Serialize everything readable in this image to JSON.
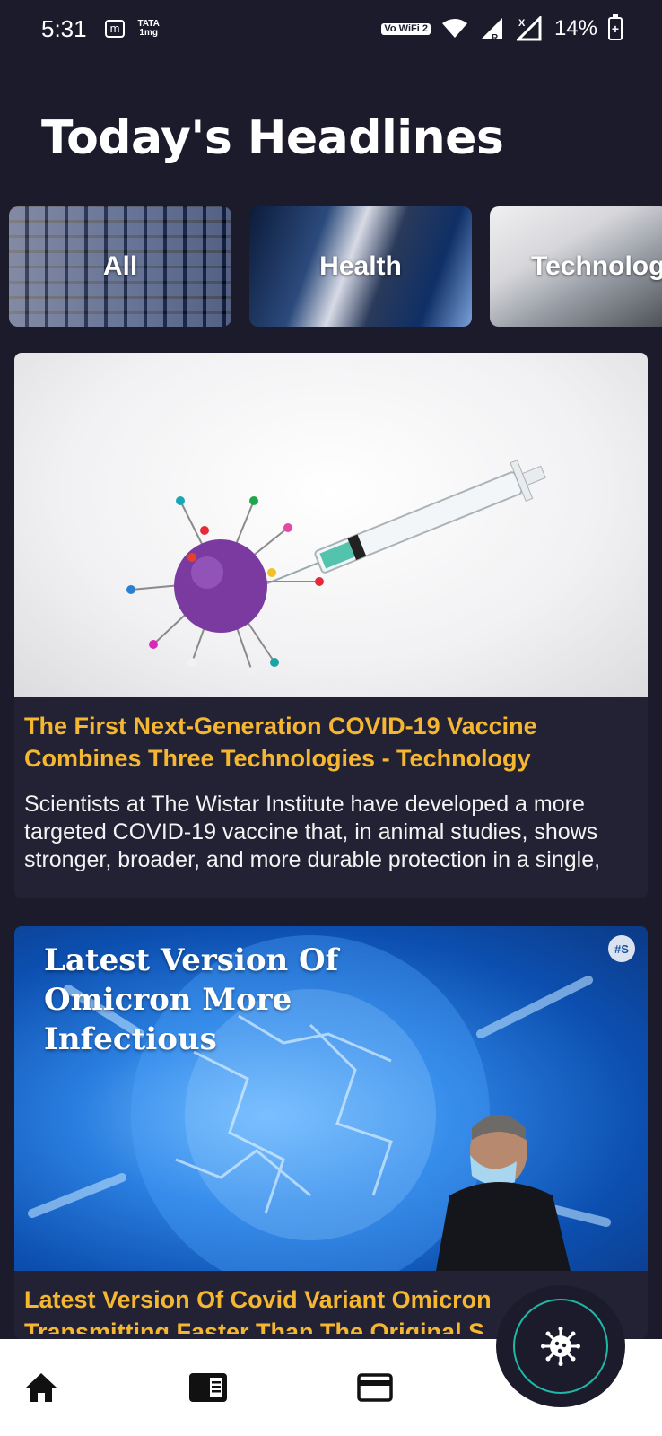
{
  "status_bar": {
    "time": "5:31",
    "left_badges": [
      "m",
      "TATA",
      "1mg"
    ],
    "network_badge": "Vo WiFi 2",
    "battery": "14%"
  },
  "page": {
    "title": "Today's Headlines"
  },
  "categories": [
    {
      "label": "All"
    },
    {
      "label": "Health"
    },
    {
      "label": "Technolog"
    }
  ],
  "articles": [
    {
      "title": "The First Next-Generation COVID-19 Vaccine Combines Three Technologies - Technology",
      "description": "Scientists at The Wistar Institute have developed a more targeted COVID-19 vaccine that, in animal studies, shows stronger, broader, and more durable protection in a single,"
    },
    {
      "image_headline": "Latest Version Of Omicron More Infectious",
      "image_badge": "#S",
      "title": "Latest Version Of Covid Variant Omicron Transmitting Faster Than The Original S"
    }
  ],
  "bottom_nav": {
    "items": [
      "home-icon",
      "reader-icon",
      "card-icon"
    ],
    "fab_icon": "virus-icon"
  },
  "colors": {
    "background": "#1c1b2b",
    "card": "#232234",
    "headline": "#f5b731",
    "fab_ring": "#1fb7a6"
  }
}
